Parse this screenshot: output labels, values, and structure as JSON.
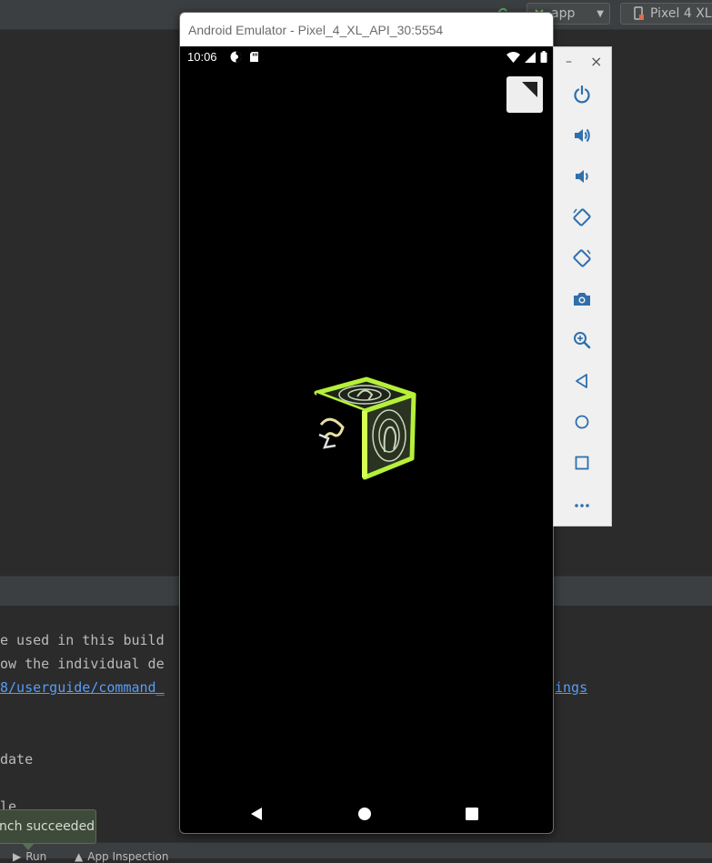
{
  "ide": {
    "run_config": "app",
    "device_config": "Pixel 4 XL",
    "console_lines": [
      "e used in this build",
      "ow the individual de",
      "8/userguide/command_",
      "ings",
      "date",
      "le"
    ],
    "toast": "nch succeeded",
    "bottom_tabs": [
      "Run",
      "App Inspection"
    ]
  },
  "emulator": {
    "title": "Android Emulator - Pixel_4_XL_API_30:5554",
    "status_time": "10:06",
    "window_controls": {
      "minimize": "–",
      "close": "×"
    },
    "toolbar": [
      "power-icon",
      "volume-up-icon",
      "volume-down-icon",
      "rotate-left-icon",
      "rotate-right-icon",
      "camera-icon",
      "zoom-icon",
      "back-icon",
      "home-icon",
      "overview-icon",
      "more-icon"
    ]
  },
  "colors": {
    "ide_bg": "#2b2b2b",
    "ide_panel": "#3c3f41",
    "link": "#589df6",
    "toolbar_icon": "#2f6fad",
    "cube_green": "#b6f03a"
  }
}
